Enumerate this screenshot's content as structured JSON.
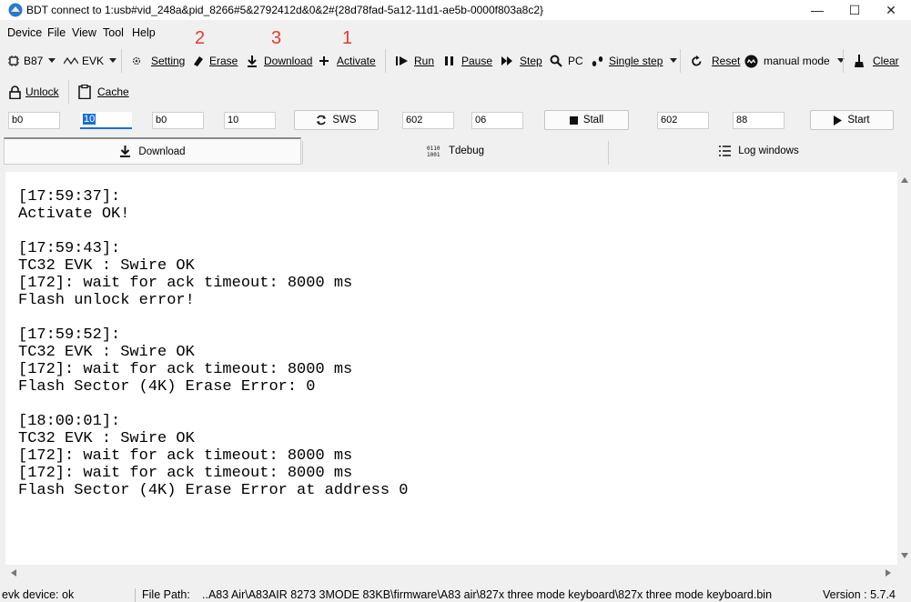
{
  "window": {
    "title": "BDT connect to 1:usb#vid_248a&pid_8266#5&2792412d&0&2#{28d78fad-5a12-11d1-ae5b-0000f803a8c2}",
    "minimize": "—",
    "maximize": "☐",
    "close": "✕"
  },
  "menu": [
    "Device",
    "File",
    "View",
    "Tool",
    "Help"
  ],
  "annotations": [
    "2",
    "3",
    "1"
  ],
  "toolbar": {
    "chip": "B87",
    "board": "EVK",
    "setting": "Setting",
    "erase": "Erase",
    "download": "Download",
    "activate": "Activate",
    "run": "Run",
    "pause": "Pause",
    "step": "Step",
    "pc": "PC",
    "single_step": "Single step",
    "reset": "Reset",
    "mode": "manual mode",
    "clear": "Clear"
  },
  "toolbar2": {
    "unlock": "Unlock",
    "cache": "Cache"
  },
  "fields": {
    "f1": "b0",
    "f2": "10",
    "f3": "b0",
    "f4": "10",
    "sws": "SWS",
    "f5": "602",
    "f6": "06",
    "stall": "Stall",
    "f7": "602",
    "f8": "88",
    "start": "Start"
  },
  "tabs": {
    "download": "Download",
    "tdebug": "Tdebug",
    "log": "Log windows"
  },
  "log_text": "[17:59:37]:\nActivate OK!\n\n[17:59:43]:\nTC32 EVK : Swire OK\n[172]: wait for ack timeout: 8000 ms\nFlash unlock error!\n\n[17:59:52]:\nTC32 EVK : Swire OK\n[172]: wait for ack timeout: 8000 ms\nFlash Sector (4K) Erase Error: 0\n\n[18:00:01]:\nTC32 EVK : Swire OK\n[172]: wait for ack timeout: 8000 ms\n[172]: wait for ack timeout: 8000 ms\nFlash Sector (4K) Erase Error at address 0",
  "status": {
    "device": "evk device: ok",
    "file_path_label": "File Path:",
    "file_path": "..A83 Air\\A83AIR 8273 3MODE 83KB\\firmware\\A83 air\\827x three mode keyboard\\827x three mode keyboard.bin",
    "version": "Version : 5.7.4"
  }
}
